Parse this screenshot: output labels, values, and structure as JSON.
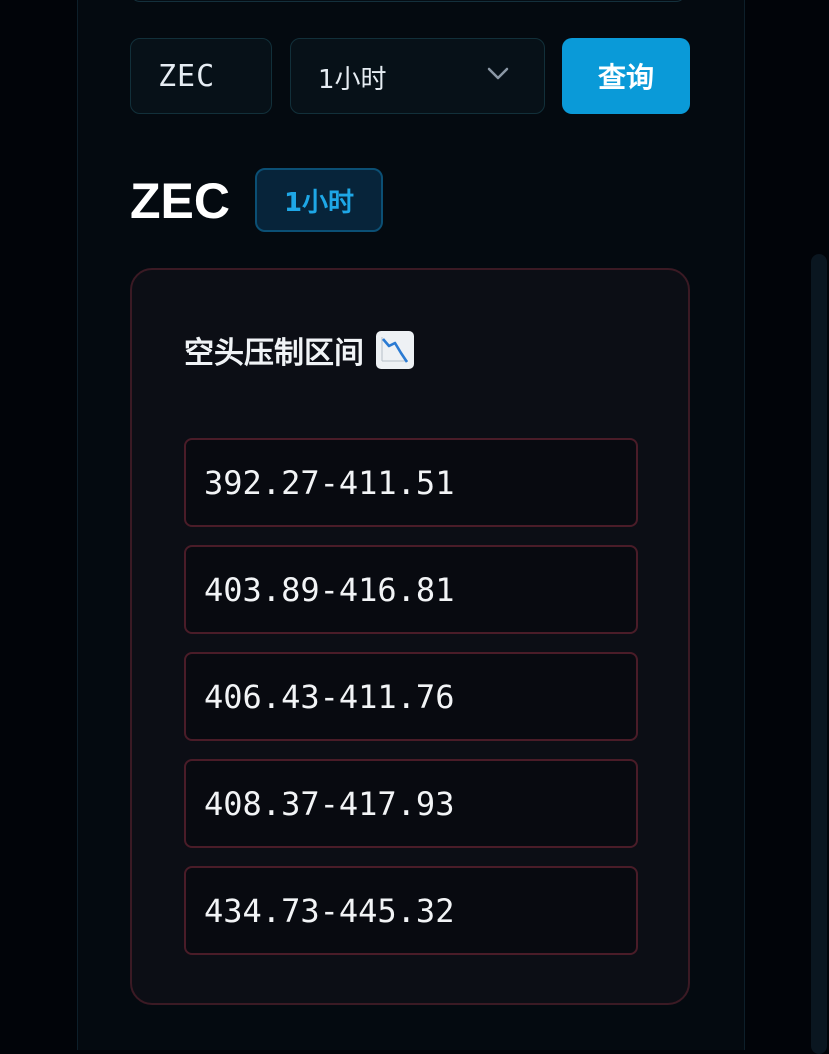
{
  "controls": {
    "symbol_value": "ZEC",
    "interval_value": "1小时",
    "query_label": "查询"
  },
  "header": {
    "symbol": "ZEC",
    "interval_badge": "1小时"
  },
  "card": {
    "title": "空头压制区间",
    "icon": "chart-decreasing-icon",
    "ranges": [
      "392.27-411.51",
      "403.89-416.81",
      "406.43-411.76",
      "408.37-417.93",
      "434.73-445.32"
    ]
  },
  "colors": {
    "accent": "#0a9ad8",
    "badge_text": "#1ea7e6",
    "card_border": "#3b1a24",
    "range_border": "#4a1c28"
  }
}
